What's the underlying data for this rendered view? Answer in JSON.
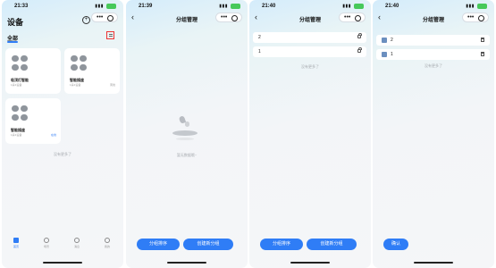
{
  "screen1": {
    "status_time": "21:33",
    "title": "设备",
    "tab_all": "全部",
    "cards": [
      {
        "name": "吸顶灯智能",
        "sub": "1房1设备",
        "status": ""
      },
      {
        "name": "智能插座",
        "sub": "1房1设备",
        "status": "离线"
      },
      {
        "name": "智能插座",
        "sub": "1房1设备",
        "status": "在线"
      }
    ],
    "no_more": "没有更多了",
    "tabs": [
      "首页",
      "场景",
      "消息",
      "我的"
    ]
  },
  "screen2": {
    "status_time": "21:39",
    "title": "分组管理",
    "empty_text": "暂无数据哦~",
    "btn_sort": "分组排序",
    "btn_create": "创建新分组"
  },
  "screen3": {
    "status_time": "21:40",
    "title": "分组管理",
    "groups": [
      "2",
      "1"
    ],
    "no_more": "没有更多了",
    "btn_sort": "分组排序",
    "btn_create": "创建新分组"
  },
  "screen4": {
    "status_time": "21:40",
    "title": "分组管理",
    "groups": [
      "2",
      "1"
    ],
    "no_more": "没有更多了",
    "btn_confirm": "确认"
  },
  "colors": {
    "accent": "#2f7df6",
    "highlight": "#e33333"
  }
}
